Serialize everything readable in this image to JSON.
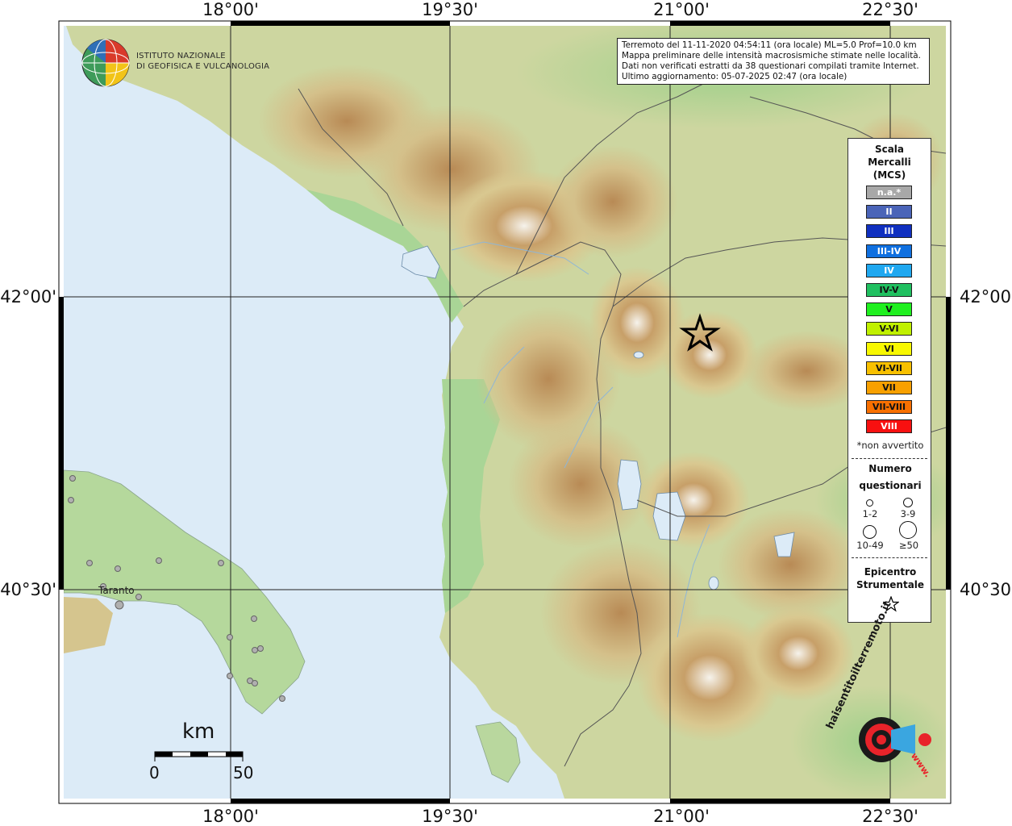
{
  "graticule": {
    "lon_labels": [
      "18°00'",
      "19°30'",
      "21°00'",
      "22°30'"
    ],
    "lat_labels": [
      "42°00'",
      "40°30'"
    ]
  },
  "institute": {
    "line1": "ISTITUTO NAZIONALE",
    "line2": "DI GEOFISICA E VULCANOLOGIA"
  },
  "info": {
    "line1": "Terremoto del 11-11-2020 04:54:11 (ora locale) ML=5.0 Prof=10.0 km",
    "line2": "Mappa preliminare delle intensità macrosismiche stimate nelle località.",
    "line3": "Dati non verificati estratti da 38 questionari compilati tramite Internet.",
    "line4": "Ultimo aggiornamento: 05-07-2025 02:47 (ora locale)"
  },
  "legend": {
    "title_line1": "Scala",
    "title_line2": "Mercalli",
    "title_line3": "(MCS)",
    "scale": [
      {
        "label": "n.a.*",
        "color": "#a8a8a8",
        "text_color": "#ffffff"
      },
      {
        "label": "II",
        "color": "#4a64b8",
        "text_color": "#ffffff"
      },
      {
        "label": "III",
        "color": "#1030c0",
        "text_color": "#ffffff"
      },
      {
        "label": "III-IV",
        "color": "#1070e0",
        "text_color": "#ffffff"
      },
      {
        "label": "IV",
        "color": "#20a8f0",
        "text_color": "#ffffff"
      },
      {
        "label": "IV-V",
        "color": "#20c060",
        "text_color": "#111111"
      },
      {
        "label": "V",
        "color": "#20f020",
        "text_color": "#111111"
      },
      {
        "label": "V-VI",
        "color": "#c0f000",
        "text_color": "#111111"
      },
      {
        "label": "VI",
        "color": "#f8f800",
        "text_color": "#111111"
      },
      {
        "label": "VI-VII",
        "color": "#f8c000",
        "text_color": "#111111"
      },
      {
        "label": "VII",
        "color": "#f8a000",
        "text_color": "#111111"
      },
      {
        "label": "VII-VIII",
        "color": "#f87000",
        "text_color": "#111111"
      },
      {
        "label": "VIII",
        "color": "#f81010",
        "text_color": "#ffffff"
      }
    ],
    "not_felt_note": "*non avvertito",
    "count_title1": "Numero",
    "count_title2": "questionari",
    "count_classes": [
      "1-2",
      "3-9",
      "10-49",
      "≥50"
    ],
    "epicenter_title1": "Epicentro",
    "epicenter_title2": "Strumentale"
  },
  "scalebar": {
    "unit": "km",
    "min": "0",
    "max": "50"
  },
  "places": {
    "taranto": "Taranto"
  },
  "watermark": {
    "text": "haisentitoilterremoto.it",
    "url_text": "www."
  },
  "colors": {
    "sea": "#dcebf7",
    "lowland": "#bfe0a8",
    "hills": "#d8c690",
    "mountains": "#b89360",
    "peaks": "#f4f1ea",
    "frame": "#000000"
  }
}
